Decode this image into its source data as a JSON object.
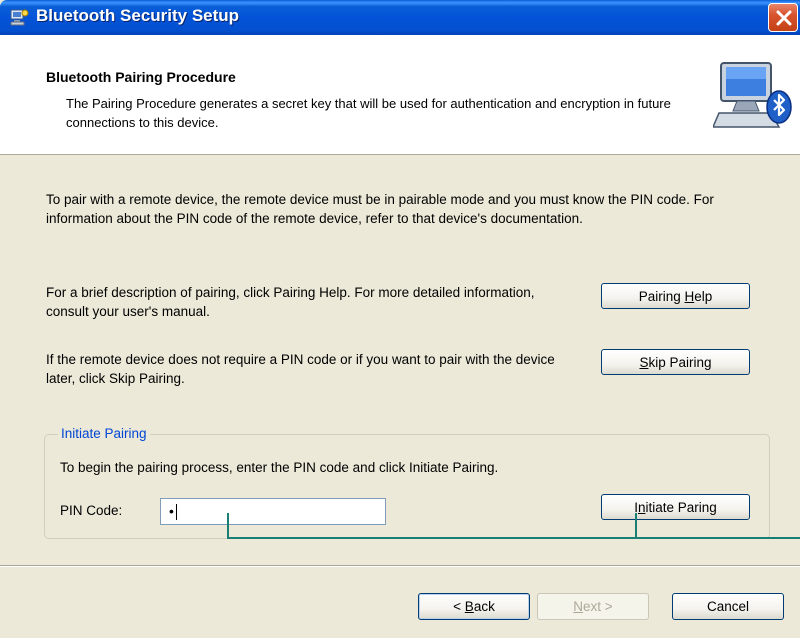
{
  "window": {
    "title": "Bluetooth Security Setup",
    "accent_color": "#0353d8",
    "close_icon": "close-icon"
  },
  "header": {
    "title": "Bluetooth Pairing Procedure",
    "description": "The Pairing Procedure generates a secret key that will be used for authentication and encryption in future connections to this device.",
    "icon": "computer-bluetooth-icon"
  },
  "body": {
    "intro": "To pair with a remote device, the remote device must be in pairable mode and you must know the PIN code.  For information about the PIN code of the remote device, refer to that device's documentation.",
    "help_text": "For a brief description of pairing, click Pairing Help.  For more detailed information, consult your user's manual.",
    "skip_text": "If the remote device does not require a PIN code or if you want to pair with the device later, click Skip Pairing."
  },
  "buttons": {
    "pairing_help": {
      "prefix": "Pairing ",
      "mnemonic": "H",
      "suffix": "elp"
    },
    "skip_pairing": {
      "prefix": "",
      "mnemonic": "S",
      "suffix": "kip Pairing"
    },
    "initiate_pairing": {
      "prefix": "I",
      "mnemonic": "n",
      "suffix": "itiate Paring"
    },
    "back": {
      "prefix": "< ",
      "mnemonic": "B",
      "suffix": "ack"
    },
    "next": {
      "prefix": "",
      "mnemonic": "N",
      "suffix": "ext >"
    },
    "cancel": "Cancel"
  },
  "initiate_group": {
    "legend": "Initiate Pairing",
    "instructions": "To begin the pairing process, enter the PIN code and click Initiate Pairing.",
    "pin_label": "PIN Code:",
    "pin_value": "•"
  }
}
